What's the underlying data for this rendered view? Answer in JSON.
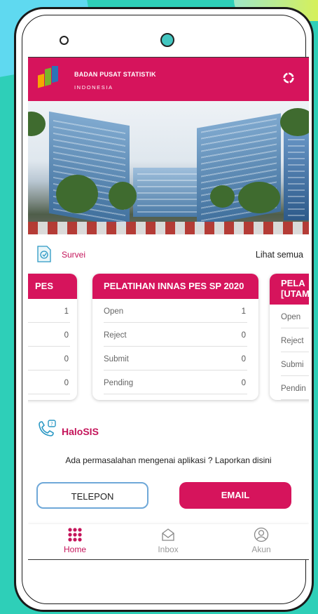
{
  "brand": {
    "name": "BADAN PUSAT STATISTIK",
    "subtitle": "INDONESIA",
    "primary_color": "#d6145c"
  },
  "survei": {
    "label": "Survei",
    "see_all": "Lihat semua"
  },
  "cards": [
    {
      "title": "PES",
      "rows": [
        {
          "label": "",
          "value": "1"
        },
        {
          "label": "",
          "value": "0"
        },
        {
          "label": "",
          "value": "0"
        },
        {
          "label": "",
          "value": "0"
        }
      ]
    },
    {
      "title": "PELATIHAN INNAS PES SP 2020",
      "rows": [
        {
          "label": "Open",
          "value": "1"
        },
        {
          "label": "Reject",
          "value": "0"
        },
        {
          "label": "Submit",
          "value": "0"
        },
        {
          "label": "Pending",
          "value": "0"
        }
      ]
    },
    {
      "title_line1": "PELA",
      "title_line2": "[UTAM",
      "rows": [
        {
          "label": "Open"
        },
        {
          "label": "Reject"
        },
        {
          "label": "Submi"
        },
        {
          "label": "Pendin"
        }
      ]
    }
  ],
  "halosis": {
    "title": "HaloSIS",
    "text": "Ada permasalahan mengenai aplikasi ? Laporkan disini",
    "telepon_label": "TELEPON",
    "email_label": "EMAIL"
  },
  "nav": {
    "home": "Home",
    "inbox": "Inbox",
    "akun": "Akun"
  }
}
